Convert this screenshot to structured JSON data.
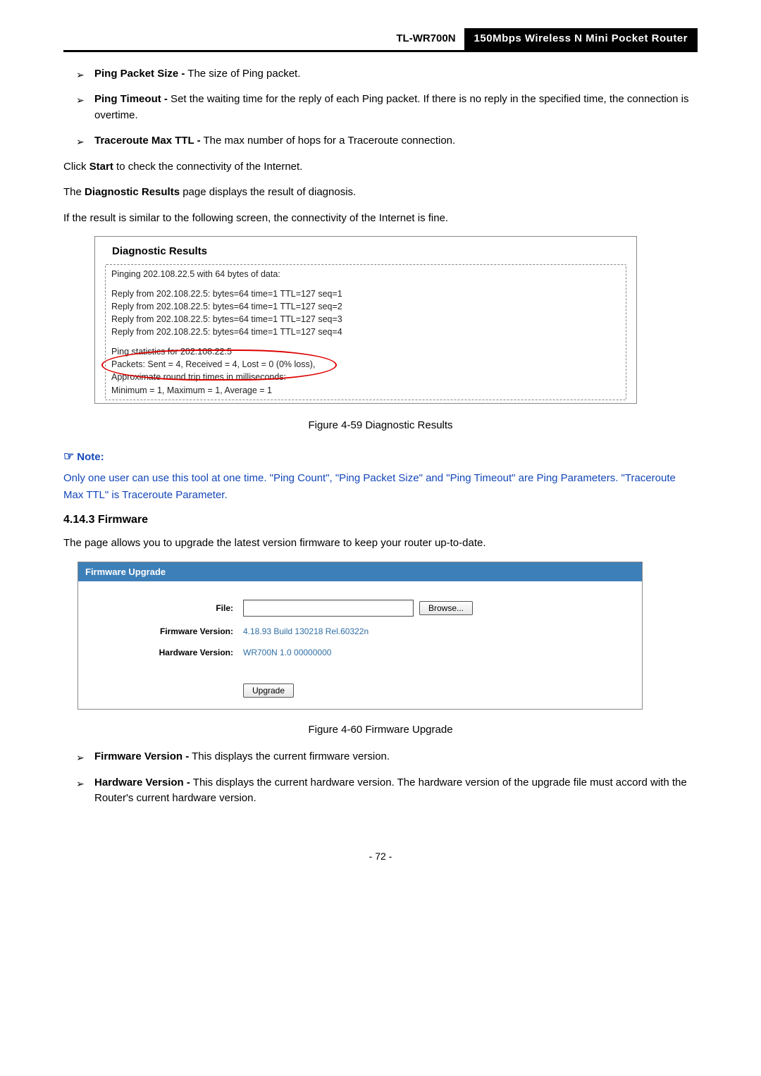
{
  "header": {
    "model": "TL-WR700N",
    "subtitle": "150Mbps  Wireless  N  Mini  Pocket  Router"
  },
  "bullets": {
    "pingPacketSize": {
      "term": "Ping Packet Size -",
      "desc": " The size of Ping packet."
    },
    "pingTimeout": {
      "term": "Ping Timeout -",
      "desc": " Set the waiting time for the reply of each Ping packet. If there is no reply in the specified time, the connection is overtime."
    },
    "tracerouteMaxTtl": {
      "term": "Traceroute Max TTL -",
      "desc": " The max number of hops for a Traceroute connection."
    }
  },
  "clickStart": {
    "pre": "Click ",
    "bold": "Start",
    "post": " to check the connectivity of the Internet."
  },
  "diagResultsLine": {
    "pre": "The ",
    "bold": "Diagnostic Results",
    "post": " page displays the result of diagnosis."
  },
  "similarLine": "If the result is similar to the following screen, the connectivity of the Internet is fine.",
  "diagBox": {
    "title": "Diagnostic Results",
    "l1": "Pinging 202.108.22.5 with 64 bytes of data:",
    "r1": "Reply from 202.108.22.5:  bytes=64  time=1  TTL=127  seq=1",
    "r2": "Reply from 202.108.22.5:  bytes=64  time=1  TTL=127  seq=2",
    "r3": "Reply from 202.108.22.5:  bytes=64  time=1  TTL=127  seq=3",
    "r4": "Reply from 202.108.22.5:  bytes=64  time=1  TTL=127  seq=4",
    "s1": "Ping statistics for 202.108.22.5",
    "s2": "  Packets: Sent = 4, Received = 4, Lost = 0 (0% loss),",
    "s3": "Approximate round trip times in milliseconds:",
    "s4": "  Minimum = 1, Maximum = 1, Average = 1"
  },
  "fig459": "Figure 4-59    Diagnostic Results",
  "note": {
    "label": "Note:",
    "body": "Only one user can use this tool at one time. \"Ping Count\", \"Ping Packet Size\" and \"Ping Timeout\" are Ping Parameters. \"Traceroute Max TTL\" is Traceroute Parameter."
  },
  "firmwareHeading": "4.14.3 Firmware",
  "firmwareIntro": "The page allows you to upgrade the latest version firmware to keep your router up-to-date.",
  "fw": {
    "panelTitle": "Firmware Upgrade",
    "fileLabel": "File:",
    "browse": "Browse...",
    "fwVerLabel": "Firmware Version:",
    "fwVer": "4.18.93 Build 130218 Rel.60322n",
    "hwVerLabel": "Hardware Version:",
    "hwVer": "WR700N 1.0 00000000",
    "upgrade": "Upgrade"
  },
  "fig460": "Figure 4-60 Firmware Upgrade",
  "bullets2": {
    "fwv": {
      "term": "Firmware Version -",
      "desc": " This displays the current firmware version."
    },
    "hwv": {
      "term": "Hardware Version -",
      "desc": " This displays the current hardware version. The hardware version of the upgrade file must accord with the Router's current hardware version."
    }
  },
  "pageNum": "- 72 -"
}
